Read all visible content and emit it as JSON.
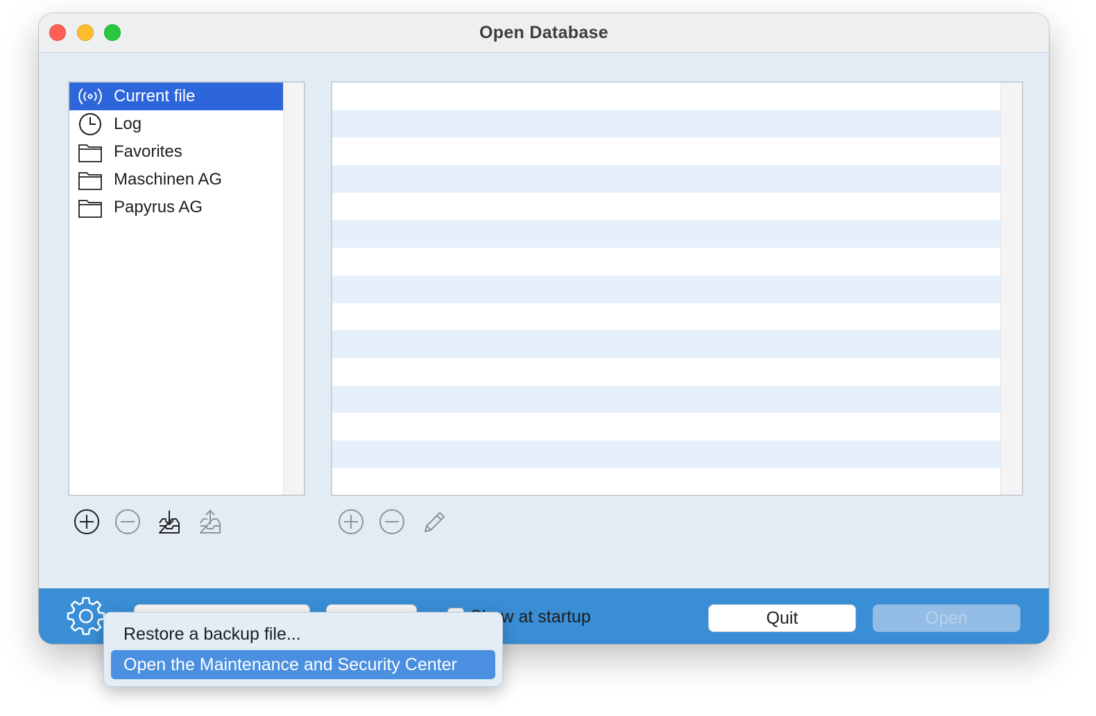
{
  "window": {
    "title": "Open Database"
  },
  "sources": {
    "items": [
      {
        "label": "Current file",
        "icon": "broadcast-icon",
        "selected": true
      },
      {
        "label": "Log",
        "icon": "clock-icon",
        "selected": false
      },
      {
        "label": "Favorites",
        "icon": "folder-icon",
        "selected": false
      },
      {
        "label": "Maschinen AG",
        "icon": "folder-icon",
        "selected": false
      },
      {
        "label": "Papyrus AG",
        "icon": "folder-icon",
        "selected": false
      }
    ]
  },
  "left_toolbar": [
    "add-icon",
    "remove-icon",
    "import-icon",
    "export-icon"
  ],
  "right_toolbar": [
    "add-icon",
    "remove-icon",
    "pencil-icon"
  ],
  "bottom": {
    "show_at_startup_label": "Show at startup",
    "show_at_startup_checked": false,
    "quit_label": "Quit",
    "open_label": "Open"
  },
  "context_menu": {
    "items": [
      {
        "label": "Restore a backup file...",
        "highlighted": false
      },
      {
        "label": "Open the Maintenance and Security Center",
        "highlighted": true
      }
    ]
  },
  "colors": {
    "selection": "#2d66da",
    "bottom_bar": "#3a8ed6",
    "menu_highlight": "#4a8fe0",
    "row_alt": "#e5f0fb"
  }
}
